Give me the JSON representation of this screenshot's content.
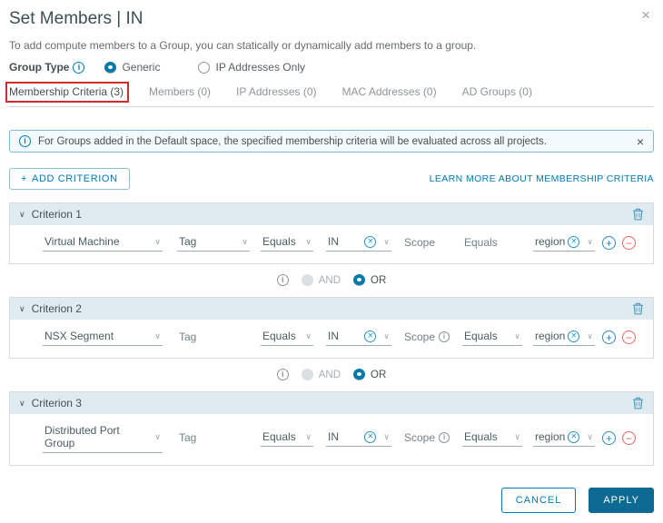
{
  "dialog": {
    "title": "Set Members | IN",
    "description": "To add compute members to a Group, you can statically or dynamically add members to a group."
  },
  "group_type": {
    "label": "Group Type",
    "options": [
      {
        "label": "Generic",
        "selected": true
      },
      {
        "label": "IP Addresses Only",
        "selected": false
      }
    ]
  },
  "tabs": [
    {
      "label": "Membership Criteria (3)",
      "active": true,
      "annotated": true
    },
    {
      "label": "Members (0)",
      "active": false
    },
    {
      "label": "IP Addresses (0)",
      "active": false
    },
    {
      "label": "MAC Addresses (0)",
      "active": false
    },
    {
      "label": "AD Groups (0)",
      "active": false
    }
  ],
  "banner": {
    "text": "For Groups added in the Default space, the specified membership criteria will be evaluated across all projects."
  },
  "toolbar": {
    "add_criterion_label": "ADD CRITERION",
    "learn_more_label": "LEARN MORE ABOUT MEMBERSHIP CRITERIA"
  },
  "criteria": [
    {
      "name": "Criterion 1",
      "type": "Virtual Machine",
      "property": "Tag",
      "operator": "Equals",
      "value": "IN",
      "scope_label": "Scope",
      "scope_operator": "Equals",
      "scope_value": "region"
    },
    {
      "name": "Criterion 2",
      "type": "NSX Segment",
      "property": "Tag",
      "operator": "Equals",
      "value": "IN",
      "scope_label": "Scope",
      "scope_operator": "Equals",
      "scope_value": "region"
    },
    {
      "name": "Criterion 3",
      "type": "Distributed Port Group",
      "property": "Tag",
      "operator": "Equals",
      "value": "IN",
      "scope_label": "Scope",
      "scope_operator": "Equals",
      "scope_value": "region"
    }
  ],
  "connector": {
    "and": "AND",
    "or": "OR",
    "and_selected": false,
    "or_selected": true
  },
  "footer": {
    "cancel": "CANCEL",
    "apply": "APPLY"
  },
  "icons": {
    "close": "×",
    "chevron_down": "∨",
    "clear": "✕",
    "plus": "+",
    "minus": "−",
    "info": "i"
  },
  "colors": {
    "accent_blue": "#0079b8",
    "primary_button": "#0e6a92",
    "danger_red": "#e0645a",
    "annotation_red": "#cc2d2d",
    "panel_header_bg": "#e0ebf1",
    "banner_bg": "#f2fafd",
    "banner_border": "#7fbcd9"
  }
}
